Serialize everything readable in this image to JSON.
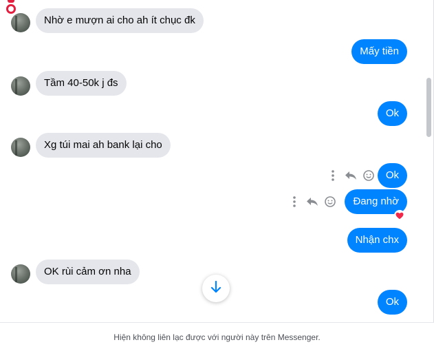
{
  "messages": [
    {
      "side": "in",
      "text": "Nhờ e mượn ai cho ah ít chục đk"
    },
    {
      "side": "out",
      "text": "Mấy tiền"
    },
    {
      "side": "in",
      "text": "Tầm 40-50k j đs"
    },
    {
      "side": "out",
      "text": "Ok"
    },
    {
      "side": "in",
      "text": "Xg túi mai ah bank lại cho"
    },
    {
      "side": "out",
      "text": "Ok",
      "actions": [
        "more-icon",
        "reply-icon",
        "emoji-icon"
      ]
    },
    {
      "side": "out",
      "text": "Đang nhờ",
      "actions": [
        "more-icon",
        "reply-icon",
        "emoji-icon"
      ],
      "reaction": "heart"
    },
    {
      "side": "out",
      "text": "Nhận chx"
    },
    {
      "side": "in",
      "text": "OK rùi cảm ơn nha"
    },
    {
      "side": "out",
      "text": "Ok"
    }
  ],
  "footer": {
    "notice": "Hiện không liên lạc được với người này trên Messenger."
  },
  "colors": {
    "outgoing": "#0084ff",
    "incoming": "#e4e6eb"
  }
}
